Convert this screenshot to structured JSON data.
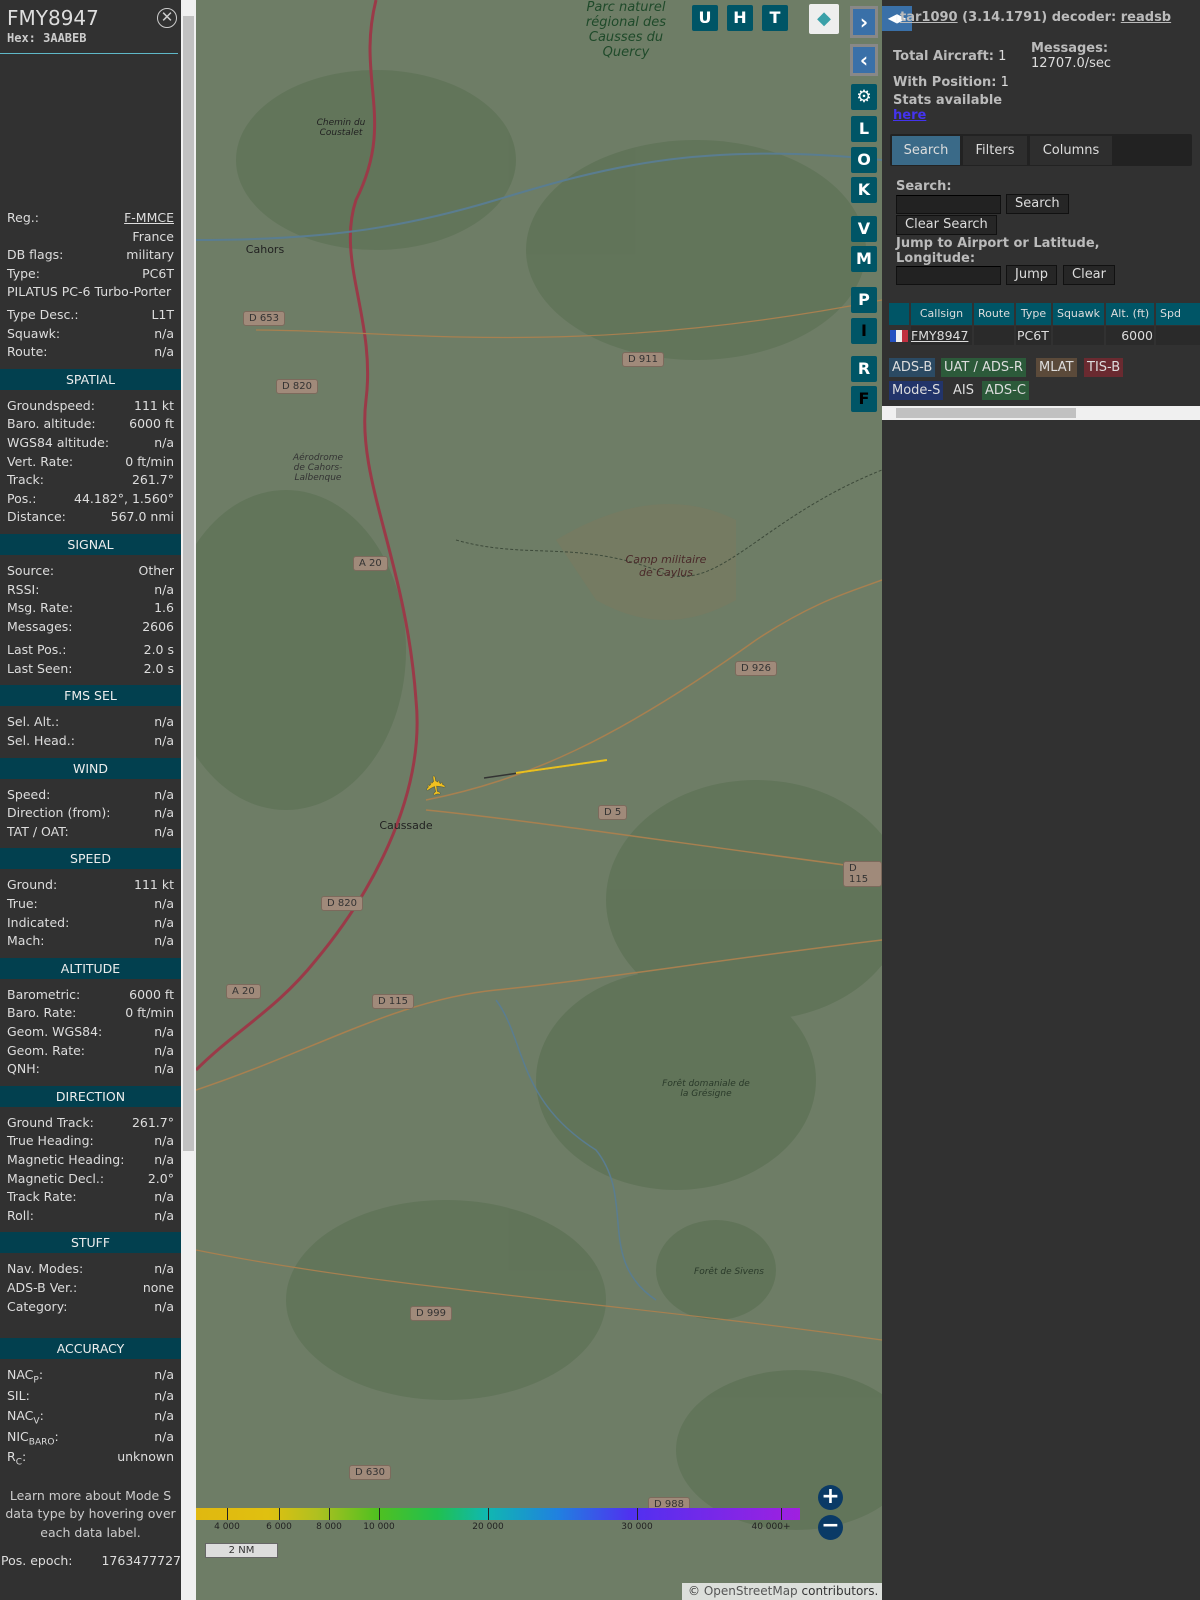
{
  "aircraft": {
    "callsign": "FMY8947",
    "hex": "Hex: 3AABEB"
  },
  "info": [
    {
      "label": "Reg.:",
      "value": "F-MMCE",
      "link": true
    },
    {
      "label": "",
      "value": "France"
    },
    {
      "label": "DB flags:",
      "value": "military"
    },
    {
      "label": "Type:",
      "value": "PC6T"
    },
    {
      "label": "PILATUS PC-6 Turbo-Porter",
      "value": ""
    },
    {
      "label": "Type Desc.:",
      "value": "L1T"
    },
    {
      "label": "Squawk:",
      "value": "n/a"
    },
    {
      "label": "Route:",
      "value": "n/a"
    }
  ],
  "sections": [
    {
      "title": "SPATIAL",
      "rows": [
        [
          "Groundspeed:",
          "111 kt"
        ],
        [
          "Baro. altitude:",
          "6000 ft"
        ],
        [
          "WGS84 altitude:",
          "n/a"
        ],
        [
          "Vert. Rate:",
          "0 ft/min"
        ],
        [
          "Track:",
          "261.7°"
        ],
        [
          "Pos.:",
          "44.182°, 1.560°"
        ],
        [
          "Distance:",
          "567.0 nmi"
        ]
      ]
    },
    {
      "title": "SIGNAL",
      "rows": [
        [
          "Source:",
          "Other"
        ],
        [
          "RSSI:",
          "n/a"
        ],
        [
          "Msg. Rate:",
          "1.6"
        ],
        [
          "Messages:",
          "2606"
        ],
        [
          "Last Pos.:",
          "2.0 s"
        ],
        [
          "Last Seen:",
          "2.0 s"
        ]
      ]
    },
    {
      "title": "FMS SEL",
      "rows": [
        [
          "Sel. Alt.:",
          "n/a"
        ],
        [
          "Sel. Head.:",
          "n/a"
        ]
      ]
    },
    {
      "title": "WIND",
      "rows": [
        [
          "Speed:",
          "n/a"
        ],
        [
          "Direction (from):",
          "n/a"
        ],
        [
          "TAT / OAT:",
          "n/a"
        ]
      ]
    },
    {
      "title": "SPEED",
      "rows": [
        [
          "Ground:",
          "111 kt"
        ],
        [
          "True:",
          "n/a"
        ],
        [
          "Indicated:",
          "n/a"
        ],
        [
          "Mach:",
          "n/a"
        ]
      ]
    },
    {
      "title": "ALTITUDE",
      "rows": [
        [
          "Barometric:",
          "6000 ft"
        ],
        [
          "Baro. Rate:",
          "0 ft/min"
        ],
        [
          "Geom. WGS84:",
          "n/a"
        ],
        [
          "Geom. Rate:",
          "n/a"
        ],
        [
          "QNH:",
          "n/a"
        ]
      ]
    },
    {
      "title": "DIRECTION",
      "rows": [
        [
          "Ground Track:",
          "261.7°"
        ],
        [
          "True Heading:",
          "n/a"
        ],
        [
          "Magnetic Heading:",
          "n/a"
        ],
        [
          "Magnetic Decl.:",
          "2.0°"
        ],
        [
          "Track Rate:",
          "n/a"
        ],
        [
          "Roll:",
          "n/a"
        ]
      ]
    },
    {
      "title": "STUFF",
      "rows": [
        [
          "Nav. Modes:",
          "n/a"
        ],
        [
          "ADS-B Ver.:",
          "none"
        ],
        [
          "Category:",
          "n/a"
        ]
      ]
    }
  ],
  "accuracy": {
    "title": "ACCURACY",
    "rows": [
      {
        "label": "NAC",
        "sub": "P",
        "value": "n/a"
      },
      {
        "label": "SIL",
        "sub": "",
        "value": "n/a"
      },
      {
        "label": "NAC",
        "sub": "V",
        "value": "n/a"
      },
      {
        "label": "NIC",
        "sub": "BARO",
        "value": "n/a"
      },
      {
        "label": "R",
        "sub": "C",
        "value": "unknown"
      }
    ]
  },
  "note": "Learn more about Mode S data type by hovering over each data label.",
  "pos_epoch": {
    "label": "Pos. epoch:",
    "value": "1763477727"
  },
  "map": {
    "top_buttons": [
      "U",
      "H",
      "T"
    ],
    "side_buttons": [
      "L",
      "O",
      "K",
      "V",
      "M",
      "P",
      "I",
      "R",
      "F"
    ],
    "road_labels": [
      "D 653",
      "D 820",
      "D 911",
      "A 20",
      "D 926",
      "D 5",
      "D 115",
      "D 820",
      "A 20",
      "D 115",
      "D 999",
      "D 630",
      "D 988"
    ],
    "places": [
      "Parc naturel régional des Causses du Quercy",
      "Chemin du Coustalet",
      "Cahors",
      "Aérodrome de Cahors-Lalbenque",
      "Camp militaire de Caylus",
      "Caussade",
      "Forêt domaniale de la Grésigne",
      "Forêt de Sivens"
    ],
    "altitude_scale": [
      "4 000",
      "6 000",
      "8 000",
      "10 000",
      "20 000",
      "30 000",
      "40 000+"
    ],
    "scale_bar": "2 NM",
    "attribution_prefix": "©",
    "attribution_link": "OpenStreetMap",
    "attribution_suffix": "contributors."
  },
  "header": {
    "app": "tar1090",
    "version": "(3.14.1791)",
    "decoder_label": "decoder:",
    "decoder": "readsb"
  },
  "stats": {
    "total_label": "Total Aircraft:",
    "total": "1",
    "messages_label": "Messages:",
    "messages": "12707.0/sec",
    "position_label": "With Position:",
    "position": "1",
    "stats_text": "Stats available",
    "stats_link": "here"
  },
  "tabs": [
    "Search",
    "Filters",
    "Columns"
  ],
  "search": {
    "label": "Search:",
    "value": "",
    "button": "Search",
    "clear": "Clear Search",
    "jump_label": "Jump to Airport or Latitude, Longitude:",
    "jump_value": "",
    "jump_button": "Jump",
    "clear_button": "Clear"
  },
  "table": {
    "headers": [
      "",
      "Callsign",
      "Route",
      "Type",
      "Squawk",
      "Alt. (ft)",
      "Spd"
    ],
    "rows": [
      {
        "callsign": "FMY8947",
        "route": "",
        "type": "PC6T",
        "squawk": "",
        "alt": "6000"
      }
    ]
  },
  "legend": [
    {
      "label": "ADS-B",
      "color": "#2b4a63"
    },
    {
      "label": "UAT / ADS-R",
      "color": "#2c5a3a"
    },
    {
      "label": "MLAT",
      "color": "#5b4a3a"
    },
    {
      "label": "TIS-B",
      "color": "#6a2a30"
    },
    {
      "label": "Mode-S",
      "color": "#22346a"
    },
    {
      "label": "AIS",
      "color": "#313131"
    },
    {
      "label": "ADS-C",
      "color": "#2c5a3a"
    }
  ]
}
